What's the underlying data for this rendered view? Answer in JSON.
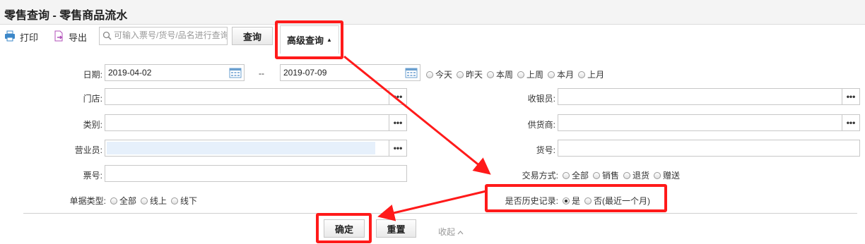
{
  "header": {
    "title": "零售查询 - 零售商品流水"
  },
  "toolbar": {
    "print_label": "打印",
    "export_label": "导出",
    "search_placeholder": "可输入票号/货号/品名进行查询",
    "query_label": "查询",
    "advanced_label": "高级查询"
  },
  "form": {
    "date": {
      "label": "日期:",
      "start": "2019-04-02",
      "sep": "--",
      "end": "2019-07-09",
      "quick": [
        "今天",
        "昨天",
        "本周",
        "上周",
        "本月",
        "上月"
      ]
    },
    "store": {
      "label": "门店:",
      "value": ""
    },
    "category": {
      "label": "类别:",
      "value": ""
    },
    "salesperson": {
      "label": "营业员:",
      "value": ""
    },
    "ticket": {
      "label": "票号:",
      "value": ""
    },
    "doc_type": {
      "label": "单据类型:",
      "options": [
        "全部",
        "线上",
        "线下"
      ]
    },
    "cashier": {
      "label": "收银员:",
      "value": ""
    },
    "supplier": {
      "label": "供货商:",
      "value": ""
    },
    "item_no": {
      "label": "货号:",
      "value": ""
    },
    "trade_mode": {
      "label": "交易方式:",
      "options": [
        "全部",
        "销售",
        "退货",
        "赠送"
      ]
    },
    "history": {
      "label": "是否历史记录:",
      "options": [
        "是",
        "否(最近一个月)"
      ],
      "selected": "是"
    }
  },
  "actions": {
    "confirm_label": "确定",
    "reset_label": "重置",
    "collapse_label": "收起"
  },
  "colors": {
    "highlight": "#ff1a1a",
    "calendar": "#6a9fcf",
    "salesperson_fill": "#e6f0fb"
  }
}
